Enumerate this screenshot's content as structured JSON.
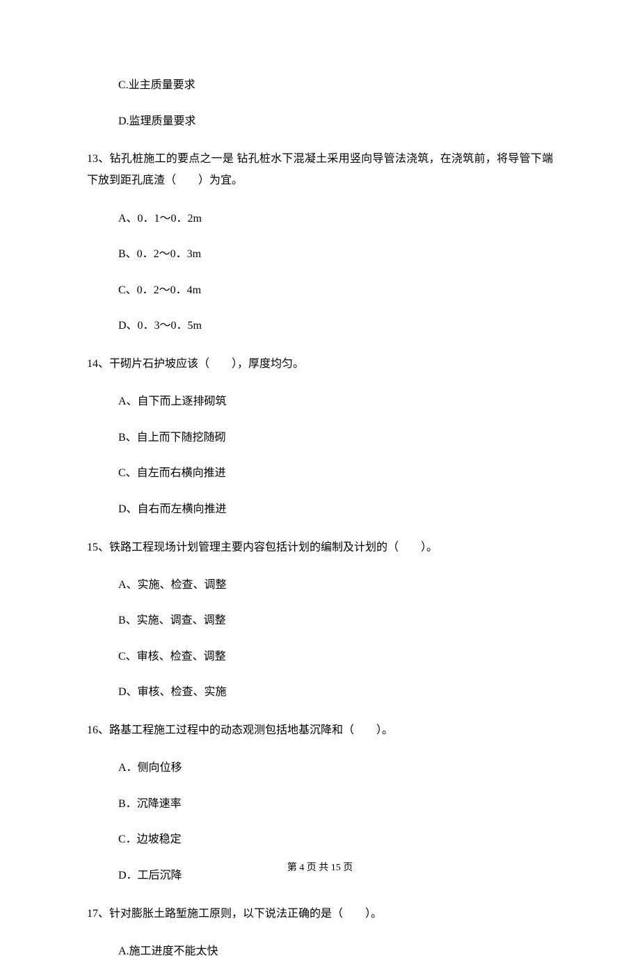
{
  "options_top": {
    "c": "C.业主质量要求",
    "d": "D.监理质量要求"
  },
  "q13": {
    "stem": "13、钻孔桩施工的要点之一是 钻孔桩水下混凝土采用竖向导管法浇筑，在浇筑前，将导管下端下放到距孔底渣（　　）为宜。",
    "a": "A、0．1～0．2m",
    "b": "B、0．2～0．3m",
    "c": "C、0．2～0．4m",
    "d": "D、0．3～0．5m"
  },
  "q14": {
    "stem": "14、干砌片石护坡应该（　　），厚度均匀。",
    "a": "A、自下而上逐排砌筑",
    "b": "B、自上而下随挖随砌",
    "c": "C、自左而右横向推进",
    "d": "D、自右而左横向推进"
  },
  "q15": {
    "stem": "15、铁路工程现场计划管理主要内容包括计划的编制及计划的（　　）。",
    "a": "A、实施、检查、调整",
    "b": "B、实施、调查、调整",
    "c": "C、审核、检查、调整",
    "d": "D、审核、检查、实施"
  },
  "q16": {
    "stem": "16、路基工程施工过程中的动态观测包括地基沉降和（　　）。",
    "a": "A．侧向位移",
    "b": "B．沉降速率",
    "c": "C．边坡稳定",
    "d": "D．工后沉降"
  },
  "q17": {
    "stem": "17、针对膨胀土路堑施工原则，以下说法正确的是（　　）。",
    "a": "A.施工进度不能太快"
  },
  "footer": "第 4 页 共 15 页"
}
